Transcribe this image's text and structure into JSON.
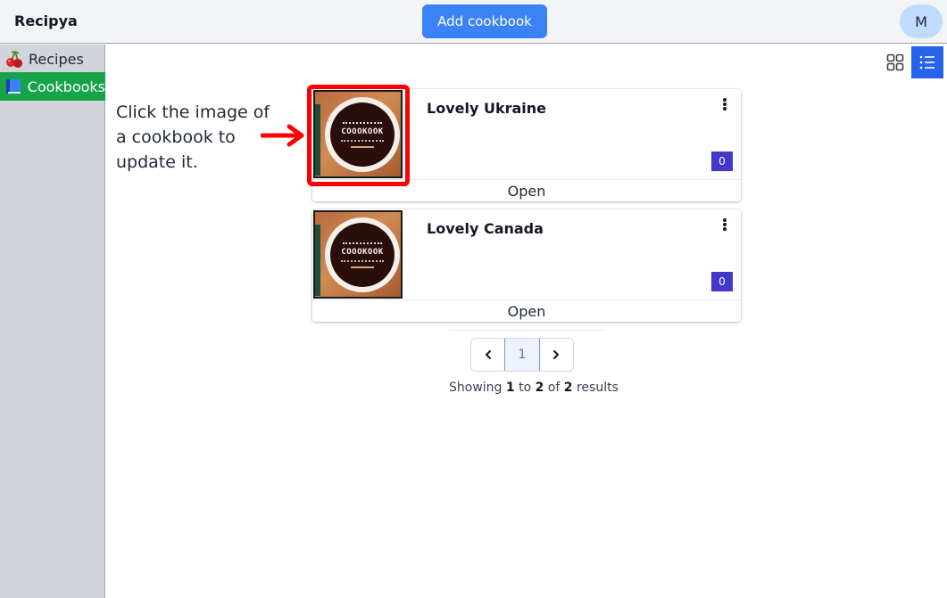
{
  "header": {
    "brand": "Recipya",
    "add_button_label": "Add cookbook",
    "avatar_initial": "M"
  },
  "sidebar": {
    "items": [
      {
        "label": "Recipes",
        "icon": "cherries-icon",
        "active": false
      },
      {
        "label": "Cookbooks",
        "icon": "blue-book-icon",
        "active": true
      }
    ]
  },
  "view_toggle": {
    "grid": "grid-view-icon",
    "list": "list-view-icon",
    "selected": "list"
  },
  "annotation": {
    "text": "Click the image of a cookbook to update it."
  },
  "cookbooks": [
    {
      "title": "Lovely Ukraine",
      "cover_text": "COOOKOOK",
      "count": "0",
      "open_label": "Open"
    },
    {
      "title": "Lovely Canada",
      "cover_text": "COOOKOOK",
      "count": "0",
      "open_label": "Open"
    }
  ],
  "pagination": {
    "current_page": "1",
    "showing_prefix": "Showing",
    "from": "1",
    "to_word": "to",
    "to": "2",
    "of_word": "of",
    "total": "2",
    "results_word": "results"
  },
  "colors": {
    "accent": "#3b82f6",
    "active_nav": "#16a34a",
    "badge": "#4338ca",
    "highlight": "#ff0000"
  }
}
